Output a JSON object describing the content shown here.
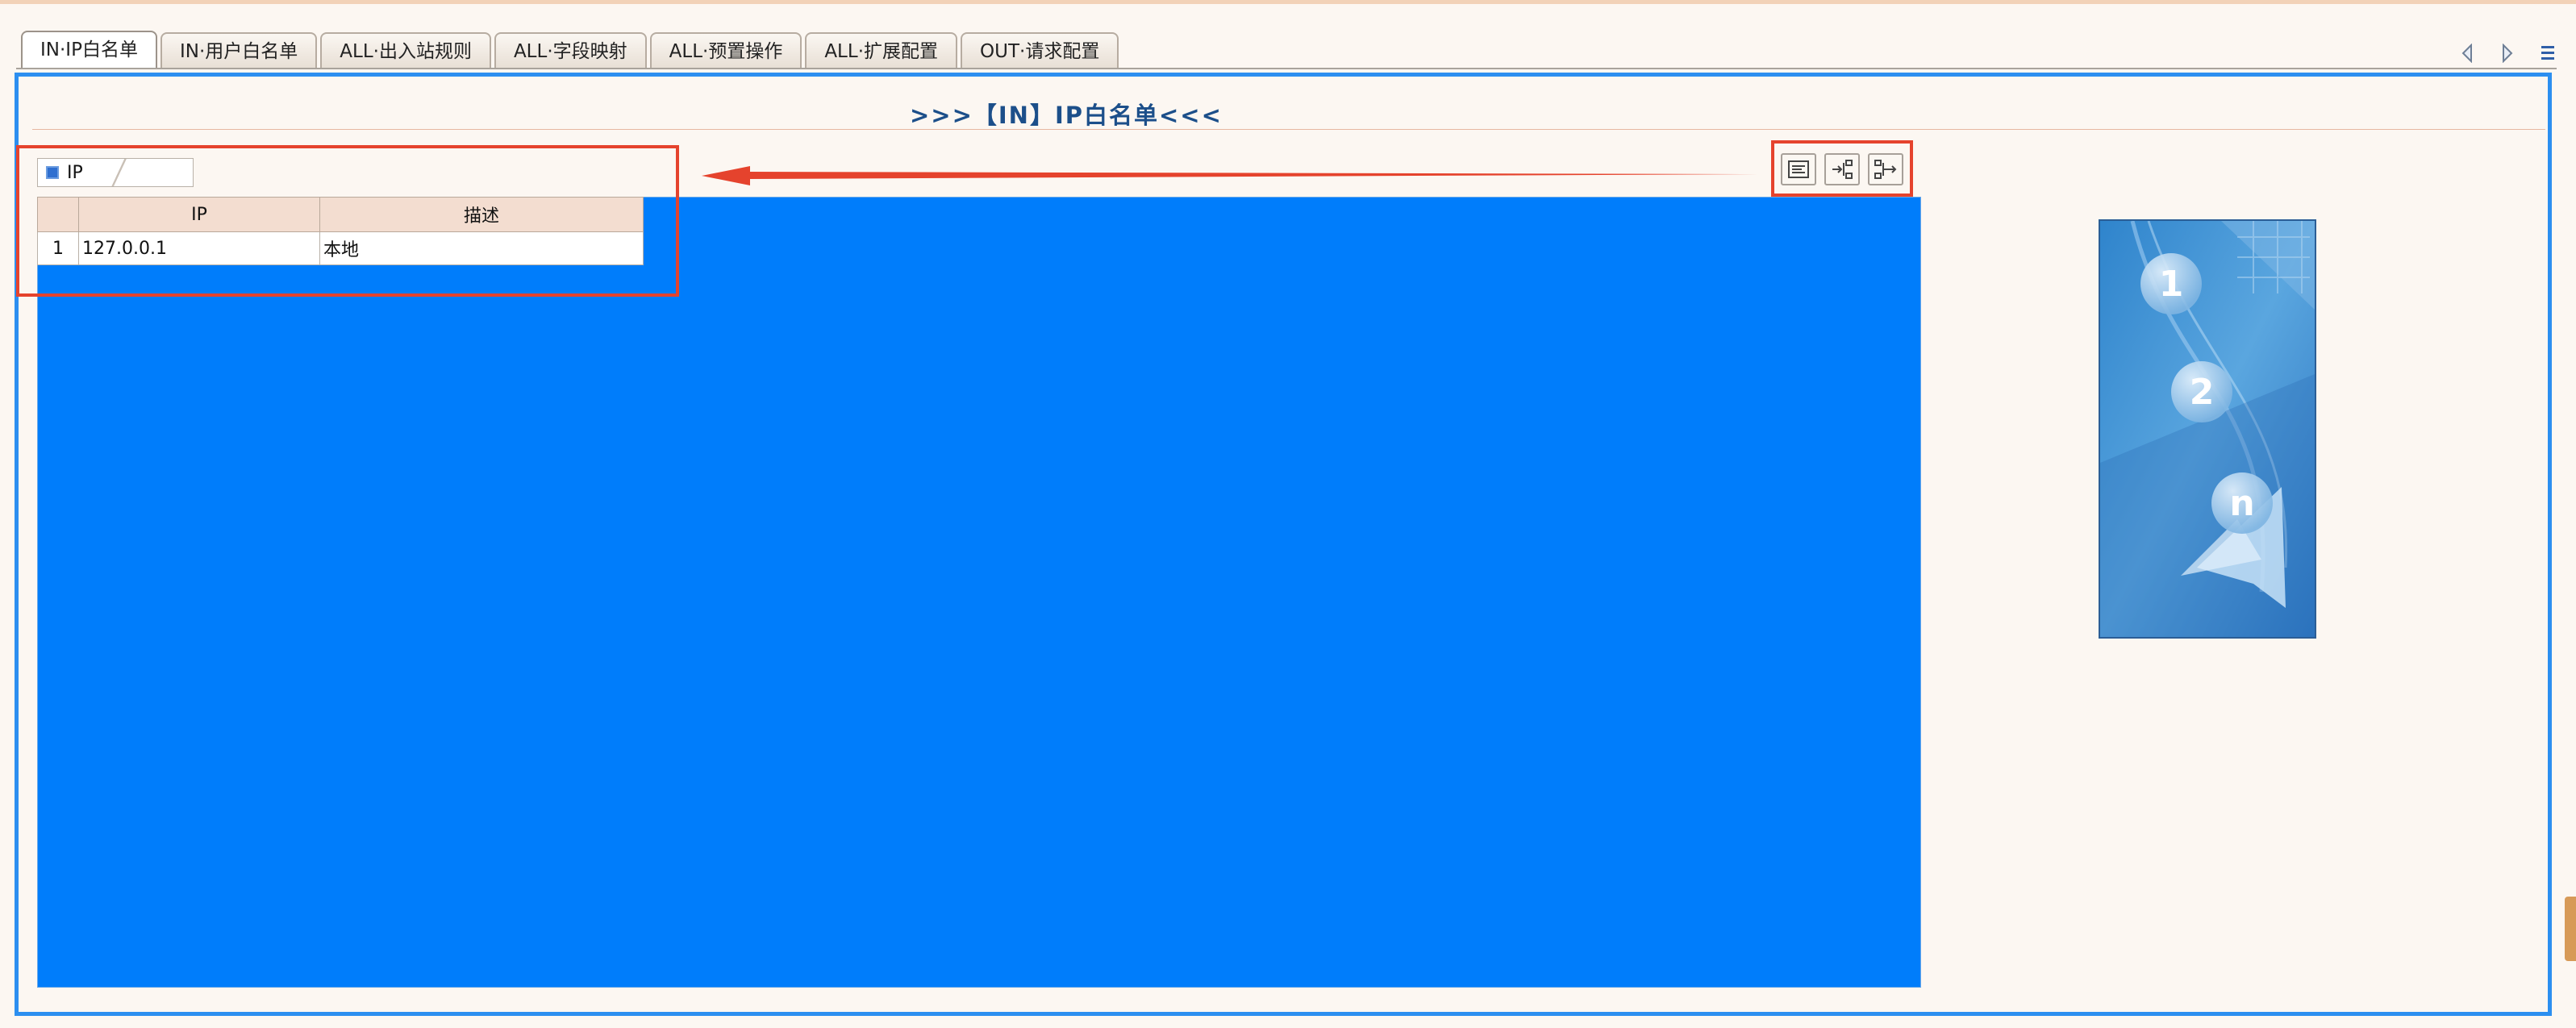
{
  "tabs": [
    {
      "label": "IN·IP白名单",
      "active": true
    },
    {
      "label": "IN·用户白名单",
      "active": false
    },
    {
      "label": "ALL·出入站规则",
      "active": false
    },
    {
      "label": "ALL·字段映射",
      "active": false
    },
    {
      "label": "ALL·预置操作",
      "active": false
    },
    {
      "label": "ALL·扩展配置",
      "active": false
    },
    {
      "label": "OUT·请求配置",
      "active": false
    }
  ],
  "page_title": ">>>【IN】IP白名单<<<",
  "grid": {
    "tab_label": "IP",
    "columns": [
      "IP",
      "描述"
    ],
    "rows": [
      {
        "num": "1",
        "ip": "127.0.0.1",
        "desc": "本地"
      }
    ]
  },
  "toolbar_icons": [
    "expand-collapse-icon",
    "tree-expand-icon",
    "tree-collapse-icon"
  ],
  "illustration": {
    "steps": [
      "1",
      "2",
      "n"
    ]
  },
  "colors": {
    "accent": "#2c8ff0",
    "grid_area": "#007dfb",
    "annotation_red": "#e5432d",
    "title": "#1c4f8a",
    "header_bg": "#f3ddd0"
  }
}
